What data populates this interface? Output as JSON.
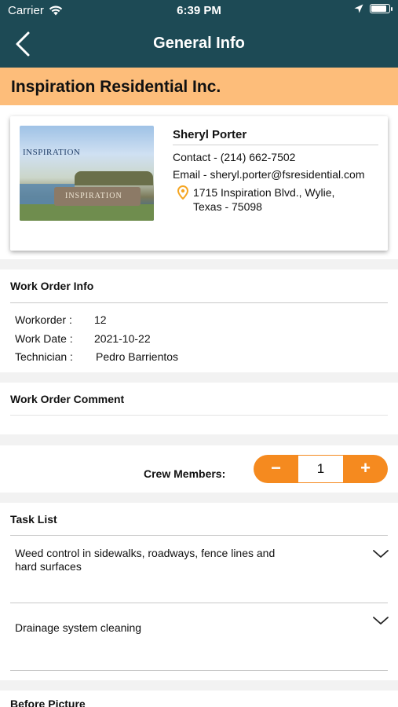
{
  "status_bar": {
    "carrier": "Carrier",
    "time": "6:39 PM",
    "battery_level": 0.9
  },
  "nav": {
    "title": "General Info",
    "back_icon": "chevron-left-icon"
  },
  "company": {
    "name": "Inspiration Residential Inc."
  },
  "contact": {
    "name": "Sheryl Porter",
    "phone": "Contact - (214) 662-7502",
    "email": "Email - sheryl.porter@fsresidential.com",
    "address_line1": "1715 Inspiration Blvd., Wylie,",
    "address_line2": "Texas - 75098",
    "image_text_top": "INSPIRATION",
    "image_text_wall": "INSPIRATION"
  },
  "work_order": {
    "title": "Work Order Info",
    "rows": [
      {
        "label": "Workorder :",
        "value": "12"
      },
      {
        "label": "Work Date :",
        "value": "2021-10-22"
      },
      {
        "label": "Technician :",
        "value": "Pedro Barrientos"
      }
    ]
  },
  "comment": {
    "title": "Work Order Comment"
  },
  "crew": {
    "label": "Crew Members:",
    "minus": "−",
    "value": "1",
    "plus": "+"
  },
  "tasks": {
    "title": "Task List",
    "items": [
      {
        "line1": "Weed control in sidewalks, roadways, fence lines and",
        "line2": "hard surfaces"
      },
      {
        "line1": "Drainage system cleaning",
        "line2": ""
      }
    ]
  },
  "before_picture": {
    "title": "Before Picture"
  },
  "colors": {
    "nav": "#1d4a55",
    "company_band": "#fdbd7a",
    "accent": "#f58a1f"
  }
}
